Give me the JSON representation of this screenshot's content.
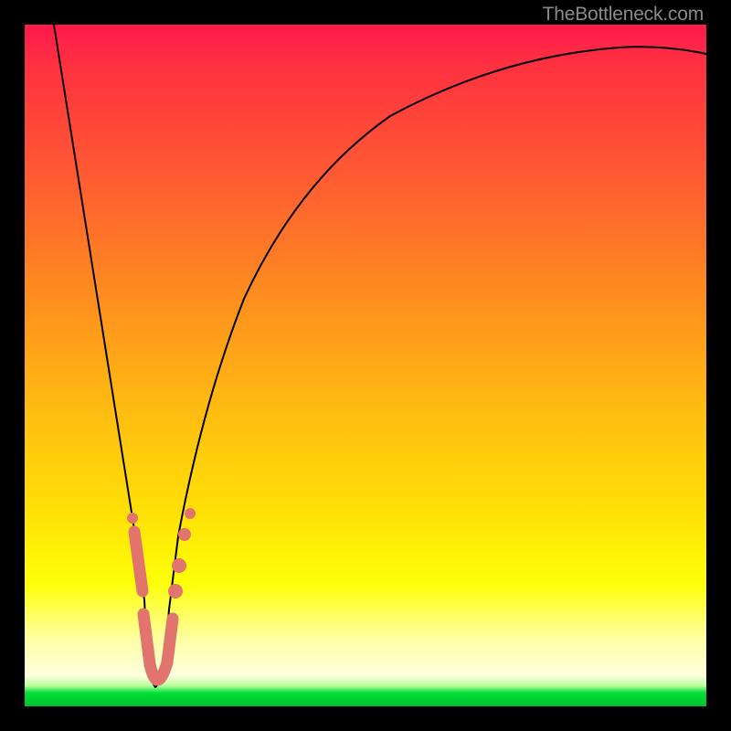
{
  "watermark": "TheBottleneck.com",
  "colors": {
    "bead": "#e2746e",
    "curve": "#000000",
    "frame": "#000000"
  },
  "chart_data": {
    "type": "line",
    "title": "",
    "xlabel": "",
    "ylabel": "",
    "xlim": [
      0,
      100
    ],
    "ylim": [
      0,
      100
    ],
    "grid": false,
    "legend": false,
    "note": "Bottleneck-style V-curve. x≈relative component scale, y≈bottleneck %. Minimum (0% bottleneck) occurs near x≈18. Values estimated from pixel positions.",
    "series": [
      {
        "name": "bottleneck-curve",
        "x": [
          4,
          6,
          8,
          10,
          12,
          14,
          16,
          17,
          18,
          19,
          20,
          22,
          25,
          30,
          35,
          40,
          50,
          60,
          70,
          80,
          90,
          100
        ],
        "y": [
          100,
          87,
          73,
          59,
          45,
          31,
          16,
          8,
          0,
          7,
          14,
          25,
          38,
          53,
          63,
          70,
          79,
          85,
          89,
          91,
          93,
          94
        ]
      }
    ],
    "annotations": {
      "optimal_x": 18,
      "optimal_y": 0,
      "bead_cluster_y_range": [
        0,
        27
      ]
    }
  }
}
